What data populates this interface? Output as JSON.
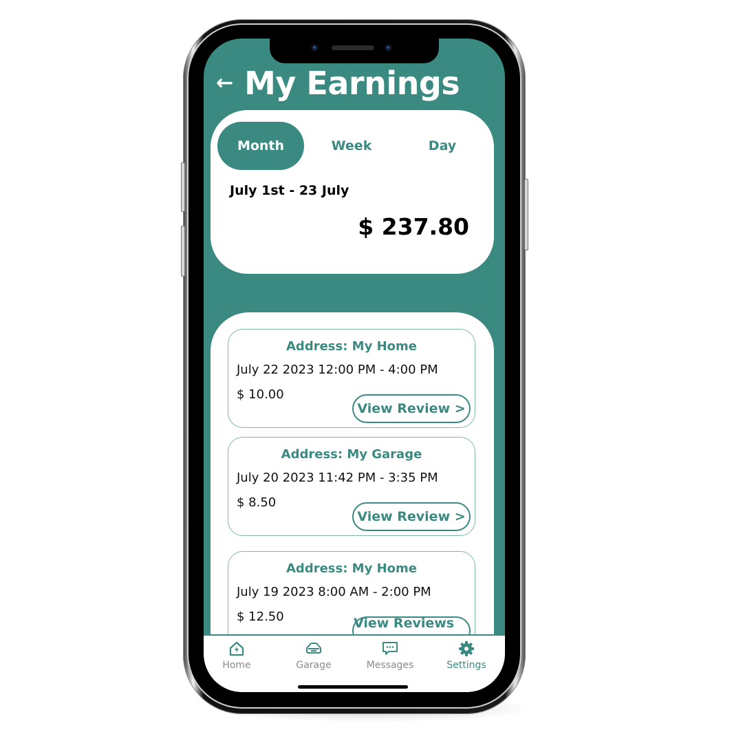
{
  "colors": {
    "accent": "#3b8a82",
    "card_border": "#7fb5af",
    "text": "#111111",
    "inactive_tab": "#8a8a8a"
  },
  "header": {
    "back_icon": "arrow-left-icon",
    "back_glyph": "←",
    "title": "My Earnings"
  },
  "summary": {
    "periods": [
      {
        "label": "Month",
        "active": true
      },
      {
        "label": "Week",
        "active": false
      },
      {
        "label": "Day",
        "active": false
      }
    ],
    "range": "July 1st - 23 July",
    "total": "$ 237.80"
  },
  "sessions": [
    {
      "address": "Address: My Home",
      "when": "July 22 2023 12:00 PM - 4:00 PM",
      "amount": "$ 10.00",
      "action": "View Review >"
    },
    {
      "address": "Address: My Garage",
      "when": "July 20 2023 11:42 PM - 3:35 PM",
      "amount": "$ 8.50",
      "action": "View Review >"
    },
    {
      "address": "Address: My Home",
      "when": "July 19 2023 8:00 AM - 2:00 PM",
      "amount": "$ 12.50",
      "action": "View Reviews >"
    }
  ],
  "tabbar": {
    "items": [
      {
        "label": "Home",
        "icon": "home-bolt-icon",
        "active": false
      },
      {
        "label": "Garage",
        "icon": "car-icon",
        "active": false
      },
      {
        "label": "Messages",
        "icon": "chat-bubble-icon",
        "active": false
      },
      {
        "label": "Settings",
        "icon": "gear-icon",
        "active": true
      }
    ]
  }
}
